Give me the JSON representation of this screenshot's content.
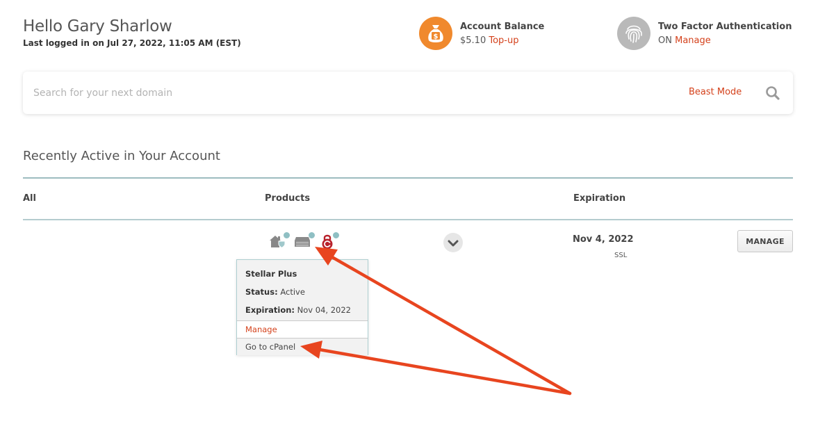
{
  "header": {
    "greeting": "Hello Gary Sharlow",
    "last_login": "Last logged in on Jul 27, 2022, 11:05 AM (EST)"
  },
  "account_balance": {
    "title": "Account Balance",
    "amount": "$5.10",
    "action": "Top-up",
    "icon": "money-bag-icon",
    "color": "#f0892d"
  },
  "two_factor": {
    "title": "Two Factor Authentication",
    "status": "ON",
    "action": "Manage",
    "icon": "fingerprint-icon",
    "color": "#b9b9b9"
  },
  "search": {
    "placeholder": "Search for your next domain",
    "mode_label": "Beast Mode"
  },
  "recent": {
    "title": "Recently Active in Your Account",
    "columns": [
      "All",
      "Products",
      "Expiration"
    ],
    "row": {
      "product_icons": [
        "domain-shield-icon",
        "hosting-server-icon",
        "ssl-certificate-icon"
      ],
      "expiration_date": "Nov 4, 2022",
      "expiration_type": "SSL",
      "manage_label": "MANAGE"
    }
  },
  "popover": {
    "plan": "Stellar Plus",
    "status_label": "Status:",
    "status_value": "Active",
    "expiration_label": "Expiration:",
    "expiration_value": "Nov 04, 2022",
    "manage_link": "Manage",
    "cpanel_link": "Go to cPanel"
  },
  "colors": {
    "accent": "#d4411b",
    "annotation_arrow": "#e8451f",
    "teal_rule": "#9dbcbf"
  }
}
